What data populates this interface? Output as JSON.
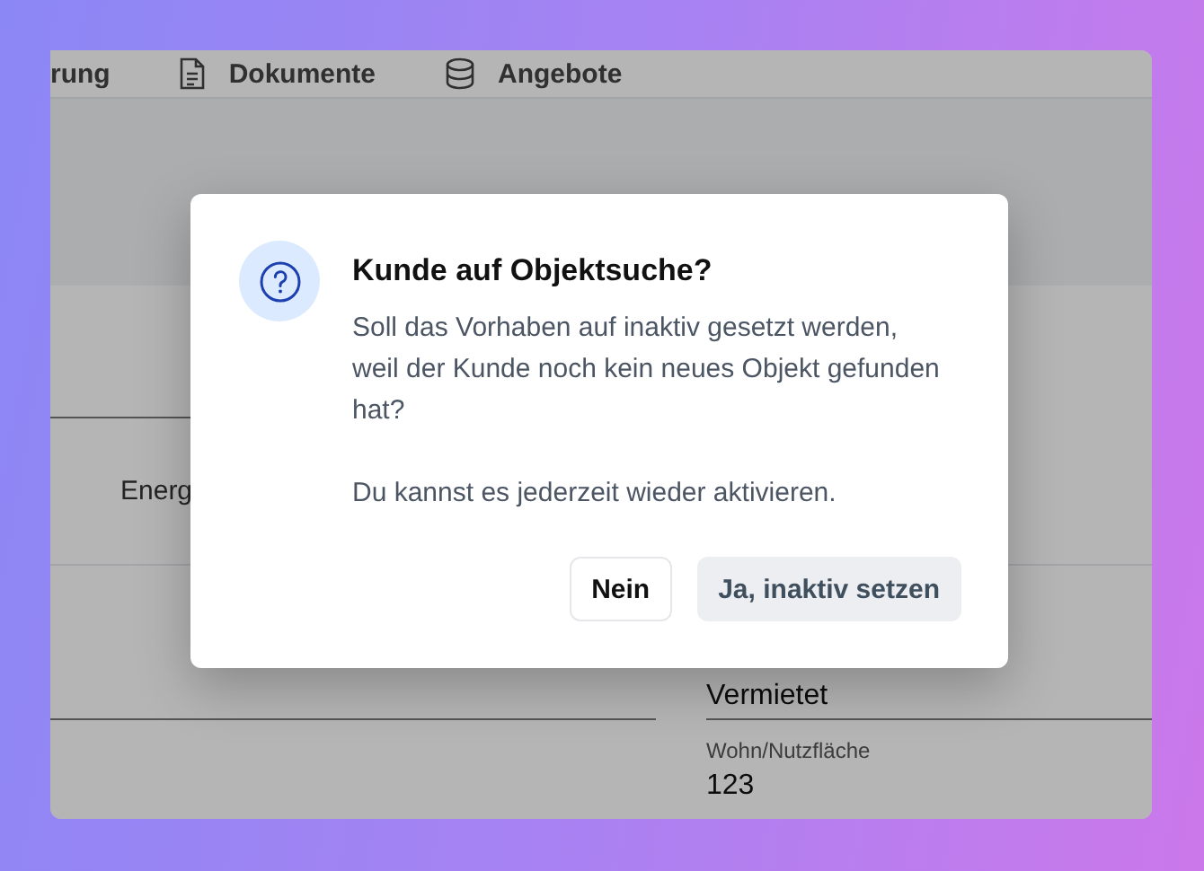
{
  "background": {
    "tabs": [
      {
        "label": "rung",
        "kind": "plain"
      },
      {
        "label": "Dokumente",
        "kind": "document"
      },
      {
        "label": "Angebote",
        "kind": "database"
      }
    ],
    "column_label": "Energ",
    "fields": [
      {
        "value": "Vermietet"
      },
      {
        "label": "Wohn/Nutzfläche",
        "value": "123"
      }
    ]
  },
  "dialog": {
    "title": "Kunde auf Objektsuche?",
    "paragraphs": [
      "Soll das Vorhaben auf inaktiv gesetzt werden, weil der Kunde noch kein neues Objekt gefunden hat?",
      "Du kannst es jederzeit wieder aktivieren."
    ],
    "buttons": [
      {
        "label": "Nein",
        "kind": "secondary"
      },
      {
        "label": "Ja, inaktiv setzen",
        "kind": "primary"
      }
    ]
  }
}
